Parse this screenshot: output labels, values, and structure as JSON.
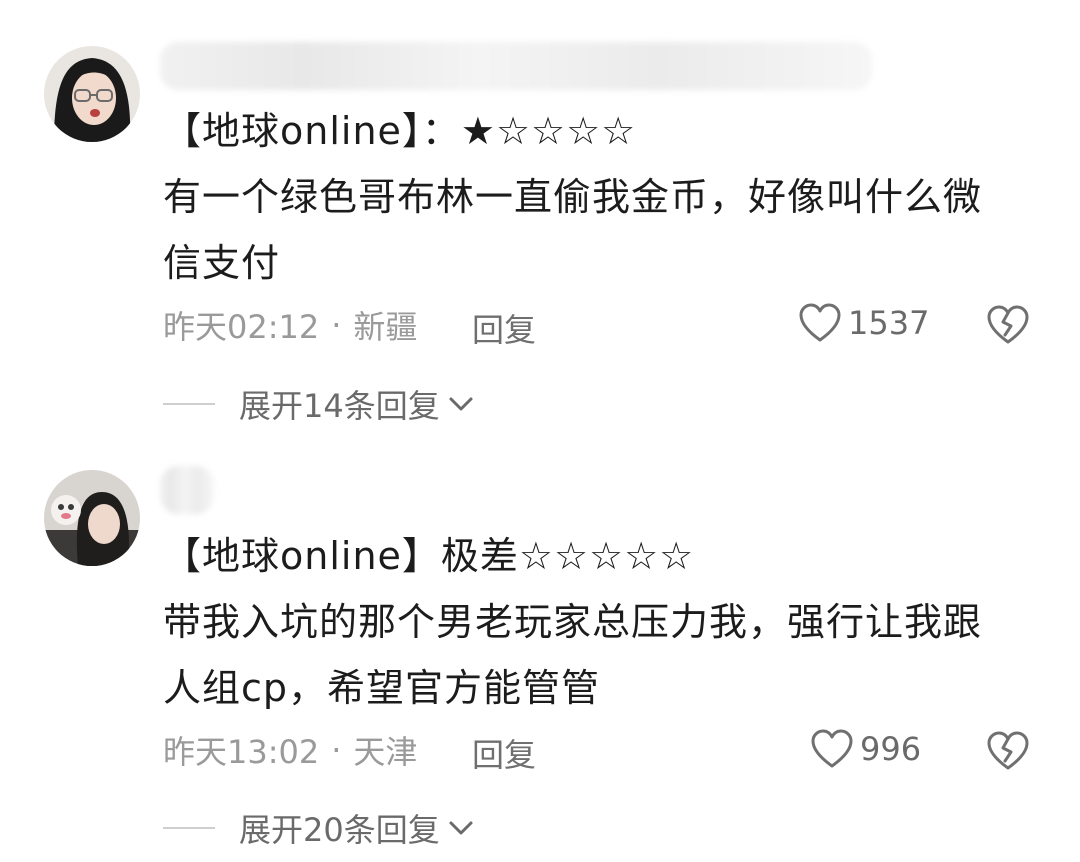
{
  "comments": [
    {
      "text_line1": "【地球online】：★☆☆☆☆",
      "text_line2": "有一个绿色哥布林一直偷我金币，好像叫什么微",
      "text_line3": "信支付",
      "time": "昨天02:12",
      "separator": "·",
      "location": "新疆",
      "reply_label": "回复",
      "likes": "1537",
      "expand_label": "展开14条回复"
    },
    {
      "text_line1": "【地球online】极差☆☆☆☆☆",
      "text_line2": "带我入坑的那个男老玩家总压力我，强行让我跟",
      "text_line3": "人组cp，希望官方能管管",
      "time": "昨天13:02",
      "separator": "·",
      "location": "天津",
      "reply_label": "回复",
      "likes": "996",
      "expand_label": "展开20条回复"
    }
  ],
  "icons": {
    "like": "heart-outline-icon",
    "dislike": "broken-heart-icon",
    "expand": "chevron-down-icon"
  },
  "colors": {
    "text": "#1c1c1c",
    "meta": "#9a9a9a",
    "action": "#6a6a6a"
  }
}
